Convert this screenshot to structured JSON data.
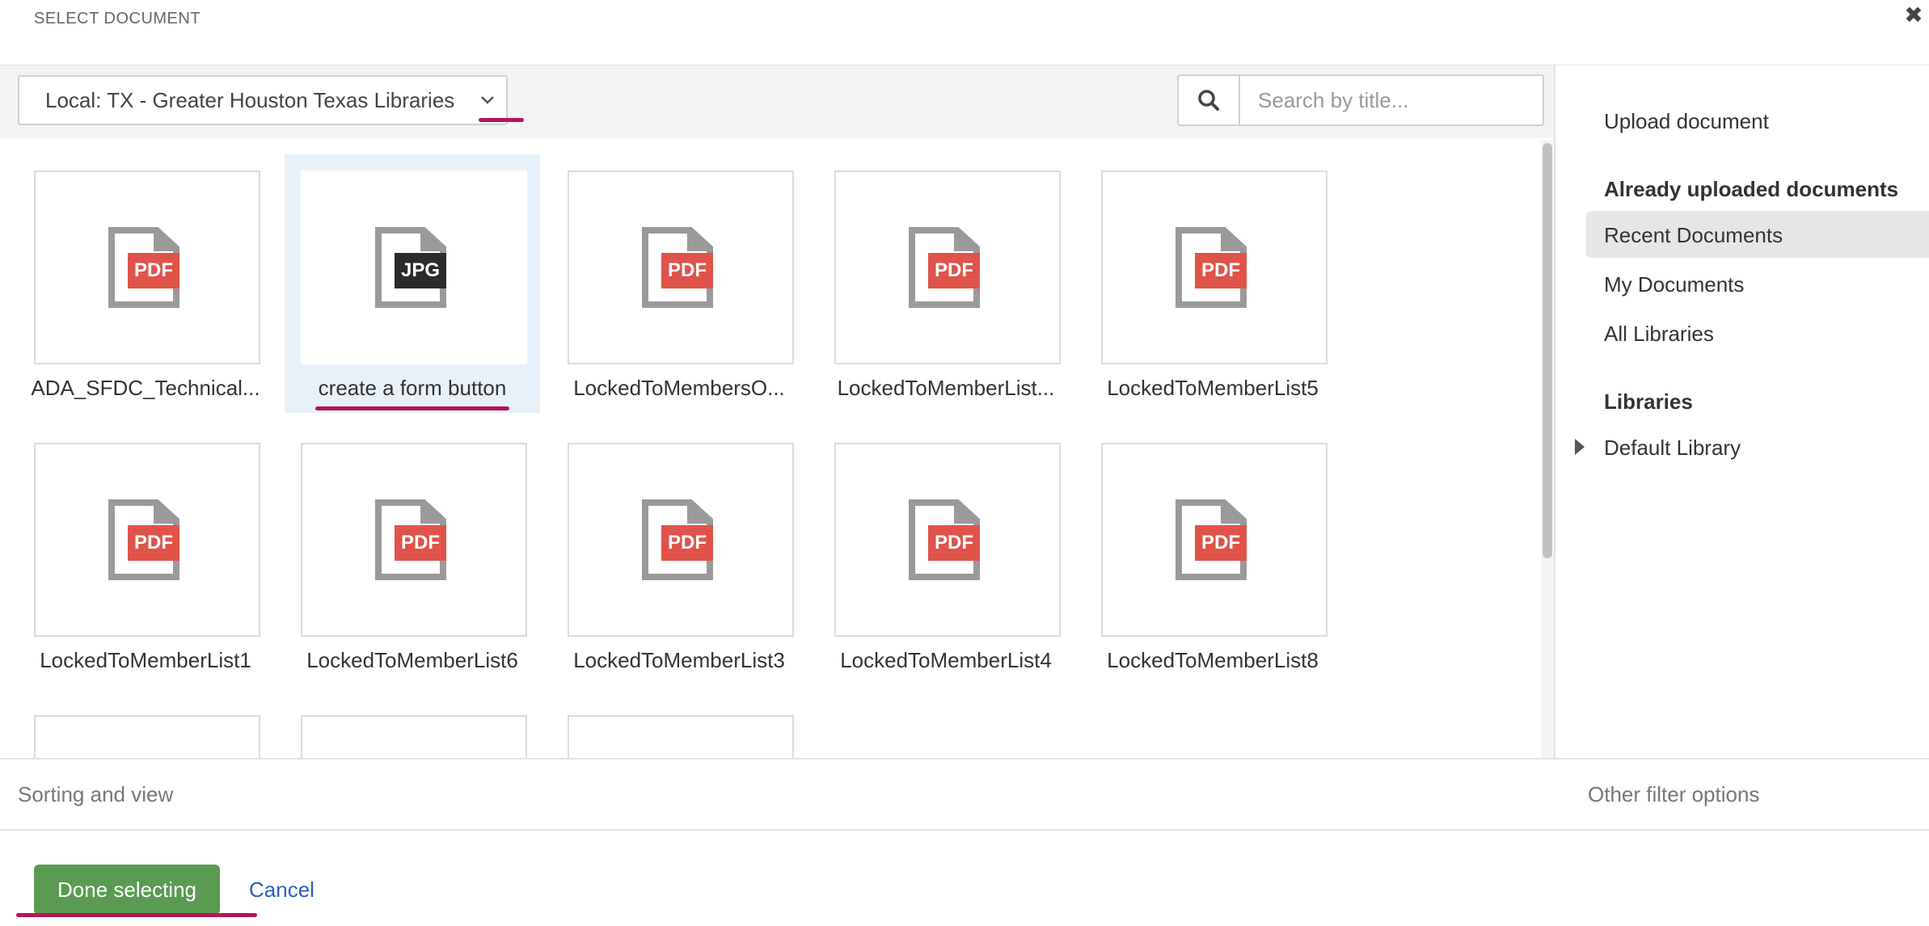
{
  "dialog": {
    "title": "SELECT DOCUMENT",
    "close_symbol": "✖"
  },
  "toolbar": {
    "library_select": "Local: TX - Greater Houston Texas Libraries",
    "search_placeholder": "Search by title..."
  },
  "documents": [
    {
      "name": "ADA_SFDC_Technical...",
      "type": "PDF",
      "selected": false
    },
    {
      "name": "create a form button",
      "type": "JPG",
      "selected": true
    },
    {
      "name": "LockedToMembersO...",
      "type": "PDF",
      "selected": false
    },
    {
      "name": "LockedToMemberList...",
      "type": "PDF",
      "selected": false
    },
    {
      "name": "LockedToMemberList5",
      "type": "PDF",
      "selected": false
    },
    {
      "name": "LockedToMemberList1",
      "type": "PDF",
      "selected": false
    },
    {
      "name": "LockedToMemberList6",
      "type": "PDF",
      "selected": false
    },
    {
      "name": "LockedToMemberList3",
      "type": "PDF",
      "selected": false
    },
    {
      "name": "LockedToMemberList4",
      "type": "PDF",
      "selected": false
    },
    {
      "name": "LockedToMemberList8",
      "type": "PDF",
      "selected": false
    }
  ],
  "badge_colors": {
    "PDF": "#e0534a",
    "JPG": "#2b2b2b"
  },
  "sidebar": {
    "upload": "Upload document",
    "uploaded_heading": "Already uploaded documents",
    "recent": "Recent Documents",
    "my_docs": "My Documents",
    "all_libraries": "All Libraries",
    "libraries_heading": "Libraries",
    "default_library": "Default Library"
  },
  "bottom": {
    "sorting": "Sorting and view",
    "other_filters": "Other filter options"
  },
  "footer": {
    "done": "Done selecting",
    "cancel": "Cancel"
  },
  "colors": {
    "accent_underline": "#b5165b",
    "done_button": "#5a9a52",
    "link": "#2b5fbd"
  }
}
